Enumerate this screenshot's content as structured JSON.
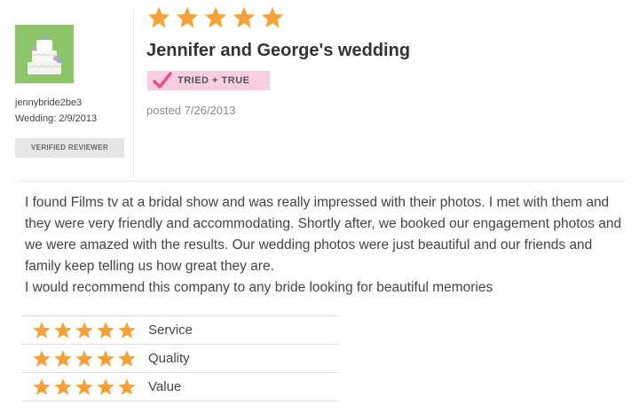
{
  "reviewer": {
    "name": "jennybride2be3",
    "wedding_date": "Wedding: 2/9/2013",
    "badge": "VERIFIED REVIEWER"
  },
  "review": {
    "rating": 5,
    "rating_max": 5,
    "title": "Jennifer and George's wedding",
    "tried_badge": "TRIED + TRUE",
    "posted": "posted 7/26/2013",
    "body": [
      "I found Films tv at a bridal show and was really impressed with their photos. I met with them and they were very friendly and accommodating. Shortly after, we booked our engagement photos and we were amazed with the results. Our wedding photos were just beautiful and our friends and family keep telling us how great they are.",
      "I would recommend this company to any bride looking for beautiful memories"
    ]
  },
  "ratings": [
    {
      "label": "Service",
      "stars": 5
    },
    {
      "label": "Quality",
      "stars": 5
    },
    {
      "label": "Value",
      "stars": 5
    }
  ],
  "colors": {
    "star": "#f5a13a",
    "badge_pink": "#f7cfe1",
    "check_pink": "#e8508a",
    "avatar_green": "#8dc56b"
  },
  "icons": {
    "star": "star-icon",
    "check": "checkmark-icon",
    "avatar": "wedding-cake-icon"
  }
}
